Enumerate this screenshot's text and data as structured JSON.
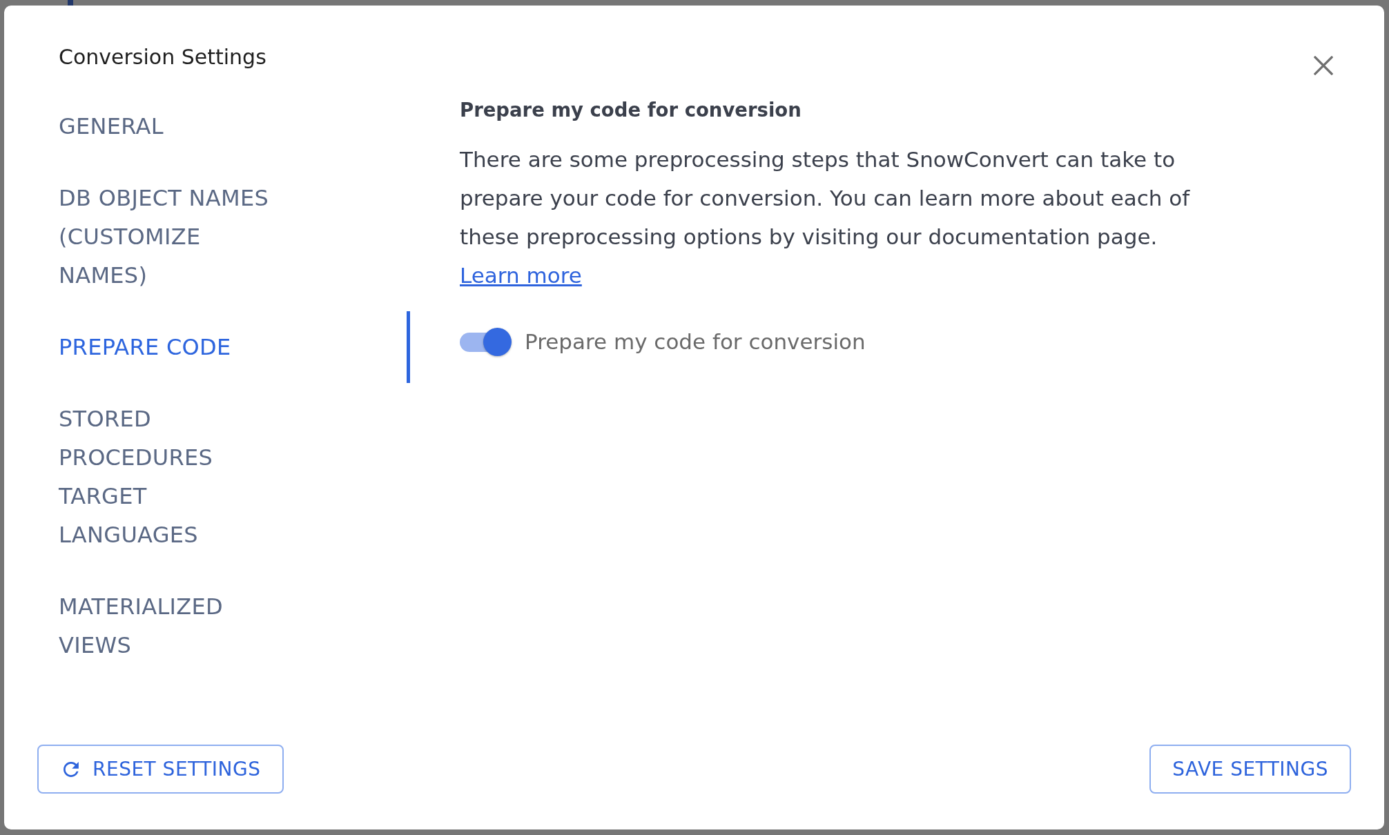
{
  "dialog": {
    "title": "Conversion Settings"
  },
  "sidebar": {
    "items": [
      {
        "label": "GENERAL",
        "selected": false
      },
      {
        "label": "DB OBJECT NAMES (CUSTOMIZE NAMES)",
        "selected": false
      },
      {
        "label": "PREPARE CODE",
        "selected": true
      },
      {
        "label": "STORED PROCEDURES TARGET LANGUAGES",
        "selected": false
      },
      {
        "label": "MATERIALIZED VIEWS",
        "selected": false
      }
    ]
  },
  "section": {
    "heading": "Prepare my code for conversion",
    "description": "There are some preprocessing steps that SnowConvert can take to prepare your code for conversion. You can learn more about each of these preprocessing options by visiting our documentation page.",
    "link": "Learn more",
    "settings": [
      {
        "kind": "toggle",
        "label": "Prepare my code for conversion",
        "on": true
      }
    ]
  },
  "footer": {
    "buttons": [
      {
        "kind": "reset",
        "label": "RESET SETTINGS"
      },
      {
        "kind": "save",
        "label": "SAVE SETTINGS"
      }
    ]
  }
}
